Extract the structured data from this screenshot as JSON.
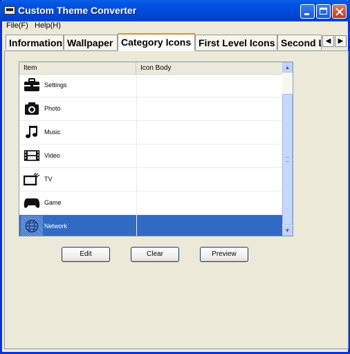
{
  "window": {
    "title": "Custom Theme Converter"
  },
  "menu": [
    "File(F)",
    "Help(H)"
  ],
  "tabs": [
    {
      "label": "Information"
    },
    {
      "label": "Wallpaper"
    },
    {
      "label": "Category Icons",
      "active": true
    },
    {
      "label": "First Level Icons"
    },
    {
      "label": "Second L"
    }
  ],
  "list": {
    "columns": [
      "Item",
      "Icon Body"
    ],
    "rows": [
      {
        "icon": "toolbox-icon",
        "label": "Settings",
        "icon_body": ""
      },
      {
        "icon": "camera-icon",
        "label": "Photo",
        "icon_body": ""
      },
      {
        "icon": "music-note-icon",
        "label": "Music",
        "icon_body": ""
      },
      {
        "icon": "film-icon",
        "label": "Video",
        "icon_body": ""
      },
      {
        "icon": "tv-icon",
        "label": "TV",
        "icon_body": ""
      },
      {
        "icon": "gamepad-icon",
        "label": "Game",
        "icon_body": ""
      },
      {
        "icon": "globe-icon",
        "label": "Network",
        "icon_body": "",
        "selected": true
      }
    ]
  },
  "buttons": {
    "edit": "Edit",
    "clear": "Clear",
    "preview": "Preview"
  },
  "colors": {
    "title_bar": "#0054e3",
    "selection": "#316ac5",
    "active_tab_accent": "#e68b2c",
    "window_bg": "#ece9d8"
  }
}
